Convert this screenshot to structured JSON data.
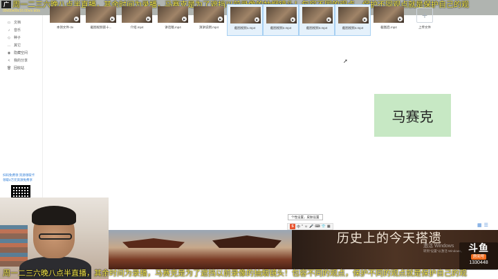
{
  "top_overlay": {
    "app_logo": "广",
    "speed_text": "00v50v00c16.00v/s b0/s",
    "marquee": "周一二三六晚八点半直播，其余时间为录播，马赛克是为了遮挡以前录像的抽烟镜头！包容不同的观点，保护不同观点就是保护自己的观"
  },
  "sidebar": {
    "items": [
      {
        "icon": "file-icon",
        "glyph": "▭",
        "label": "文档"
      },
      {
        "icon": "music-icon",
        "glyph": "♪",
        "label": "音乐"
      },
      {
        "icon": "seed-icon",
        "glyph": "◇",
        "label": "种子"
      },
      {
        "icon": "other-icon",
        "glyph": "…",
        "label": "其它"
      },
      {
        "icon": "hidden-icon",
        "glyph": "◉",
        "label": "隐藏空间"
      },
      {
        "icon": "share-icon",
        "glyph": "<",
        "label": "我的分享"
      },
      {
        "icon": "trash-icon",
        "glyph": "🗑",
        "label": "回收站"
      }
    ],
    "promo_line1": "扫码免费领 资源领取卡",
    "promo_line2": "领取2万元资源免费享"
  },
  "files": [
    {
      "name": "本领文件-3v",
      "selected": false
    },
    {
      "name": "截图视频第十...",
      "selected": false
    },
    {
      "name": "介绍.mp4",
      "selected": false
    },
    {
      "name": "讲话稿.mp4",
      "selected": false
    },
    {
      "name": "演讲说明.mp4",
      "selected": false
    },
    {
      "name": "截图视频1.mp4",
      "selected": true
    },
    {
      "name": "截图视频2.mp4",
      "selected": true
    },
    {
      "name": "截图视频3.mp4",
      "selected": true
    },
    {
      "name": "截图视频4.mp4",
      "selected": true
    },
    {
      "name": "截图后.mp4",
      "selected": false
    }
  ],
  "upload": {
    "plus": "+",
    "label": "上传文件"
  },
  "name_card": "马赛克",
  "tooltip": "个性设置，皮肤设置",
  "ime_bar": [
    "S",
    "中",
    "°",
    "☺",
    "🎤",
    "⌨",
    "👕",
    "▦"
  ],
  "view_toggles": [
    "▦",
    "☰"
  ],
  "video": {
    "title": "历史上的今天搭遗",
    "activate_line1": "激活 Windows",
    "activate_line2": "转到\"设置\"以激活 Windows。"
  },
  "douyu": {
    "logo": "斗鱼",
    "room_label": "房间号",
    "room_number": "1330448"
  },
  "bottom_marquee": "周一二三六晚八点半直播，其余时间为录播，马赛克是为了遮挡以前录像的抽烟镜头！包容不同的观点，保护不同的观点就是保护自己的观"
}
